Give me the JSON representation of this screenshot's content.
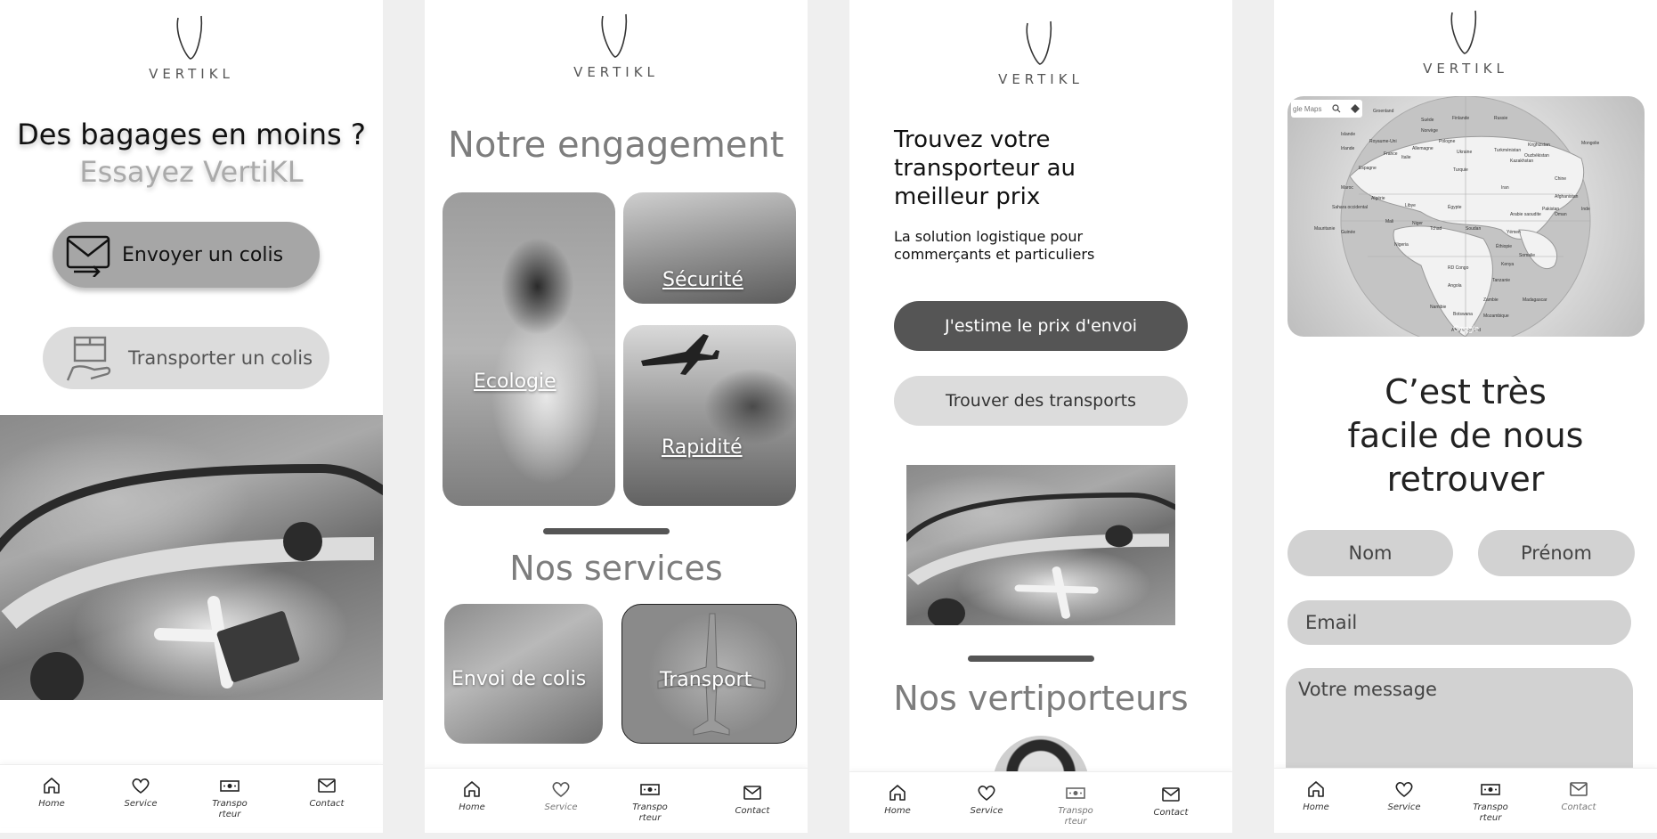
{
  "brand": {
    "logo_text": "VERTIKL"
  },
  "screen1": {
    "headline": "Des bagages en moins ?",
    "subheadline": "Essayez VertiKL",
    "send_button": "Envoyer un colis",
    "carry_button": "Transporter un colis"
  },
  "screen2": {
    "title": "Notre engagement",
    "tiles": {
      "ecologie": "Ecologie",
      "securite": "Sécurité",
      "rapidite": "Rapidité"
    },
    "services_title": "Nos services",
    "services": {
      "envoi": "Envoi de colis",
      "transport": "Transport"
    }
  },
  "screen3": {
    "title": "Trouvez votre transporteur au meilleur prix",
    "subtitle": "La solution logistique pour commerçants et particuliers",
    "estimate_button": "J'estime le prix d'envoi",
    "find_button": "Trouver des transports",
    "carriers_title": "Nos vertiporteurs"
  },
  "screen4": {
    "map_search": "gle Maps",
    "map_watermark": "Google",
    "map_places": [
      "Groenland",
      "Islande",
      "Norvège",
      "Suède",
      "Finlande",
      "Russie",
      "Royaume-Uni",
      "Irlande",
      "France",
      "Espagne",
      "Italie",
      "Pologne",
      "Allemagne",
      "Ukraine",
      "Kazakhstan",
      "Mongolie",
      "Chine",
      "Turquie",
      "Iran",
      "Afghanistan",
      "Pakistan",
      "Inde",
      "Maroc",
      "Algérie",
      "Libye",
      "Égypte",
      "Arabie saoudite",
      "Oman",
      "Sahara occidental",
      "Mali",
      "Niger",
      "Tchad",
      "Soudan",
      "Yémen",
      "Mauritanie",
      "Guinée",
      "Nigeria",
      "Éthiopie",
      "Somalie",
      "RD Congo",
      "Kenya",
      "Tanzanie",
      "Angola",
      "Zambie",
      "Namibie",
      "Botswana",
      "Mozambique",
      "Afrique du Sud",
      "Madagascar",
      "Turkménistan",
      "Kirghizstan",
      "Ouzbékistan"
    ],
    "title": "C’est très facile de nous retrouver",
    "nom_placeholder": "Nom",
    "prenom_placeholder": "Prénom",
    "email_placeholder": "Email",
    "message_placeholder": "Votre message"
  },
  "nav": {
    "home": "Home",
    "service": "Service",
    "transporteur_line1": "Transpo",
    "transporteur_line2": "rteur",
    "contact": "Contact"
  },
  "colors": {
    "background": "#efefef",
    "panel": "#ffffff",
    "pill_dark": "#555555",
    "pill_light": "#d9d9d9",
    "button_mid": "#a6a6a6",
    "text_gray": "#8a8a8a"
  },
  "icons": [
    "home-icon",
    "heart-icon",
    "banknote-icon",
    "mail-icon",
    "envelope-arrow-icon",
    "hand-box-icon",
    "search-icon",
    "locate-icon"
  ]
}
